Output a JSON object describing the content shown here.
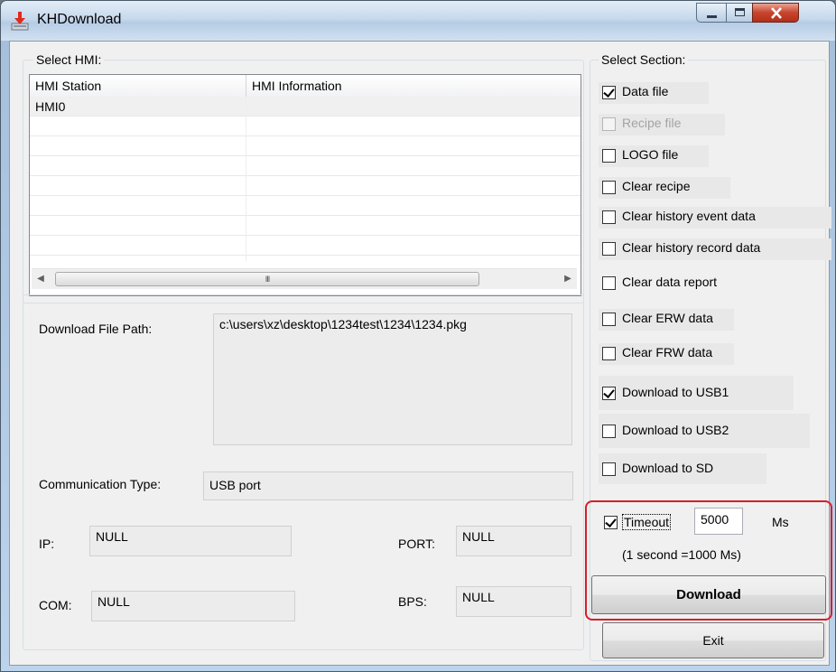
{
  "window": {
    "title": "KHDownload",
    "icon": "download-app-icon"
  },
  "select_hmi": {
    "legend": "Select HMI:",
    "columns": [
      "HMI Station",
      "HMI Information"
    ],
    "rows": [
      {
        "station": "HMI0",
        "information": ""
      }
    ],
    "scroll_thumb_grip": "III"
  },
  "details": {
    "download_file_path_label": "Download File Path:",
    "download_file_path_value": "c:\\users\\xz\\desktop\\1234test\\1234\\1234.pkg",
    "communication_type_label": "Communication Type:",
    "communication_type_value": "USB port",
    "ip_label": "IP:",
    "ip_value": "NULL",
    "port_label": "PORT:",
    "port_value": "NULL",
    "com_label": "COM:",
    "com_value": "NULL",
    "bps_label": "BPS:",
    "bps_value": "NULL"
  },
  "select_section": {
    "legend": "Select Section:",
    "items": [
      {
        "label": "Data file",
        "checked": true,
        "enabled": true
      },
      {
        "label": "Recipe file",
        "checked": false,
        "enabled": false
      },
      {
        "label": "LOGO file",
        "checked": false,
        "enabled": true
      },
      {
        "label": "Clear recipe",
        "checked": false,
        "enabled": true
      },
      {
        "label": "Clear history event data",
        "checked": false,
        "enabled": true
      },
      {
        "label": "Clear history record data",
        "checked": false,
        "enabled": true
      },
      {
        "label": "Clear data report",
        "checked": false,
        "enabled": true
      },
      {
        "label": "Clear ERW data",
        "checked": false,
        "enabled": true
      },
      {
        "label": "Clear FRW data",
        "checked": false,
        "enabled": true
      },
      {
        "label": "Download to USB1",
        "checked": true,
        "enabled": true
      },
      {
        "label": "Download to USB2",
        "checked": false,
        "enabled": true
      },
      {
        "label": "Download to SD",
        "checked": false,
        "enabled": true
      }
    ]
  },
  "timeout": {
    "label": "Timeout",
    "checked": true,
    "value": "5000",
    "unit": "Ms",
    "note": "(1 second =1000 Ms)"
  },
  "buttons": {
    "download": "Download",
    "exit": "Exit"
  },
  "colors": {
    "highlight": "#d51f2a",
    "field_bg": "#ececec"
  }
}
